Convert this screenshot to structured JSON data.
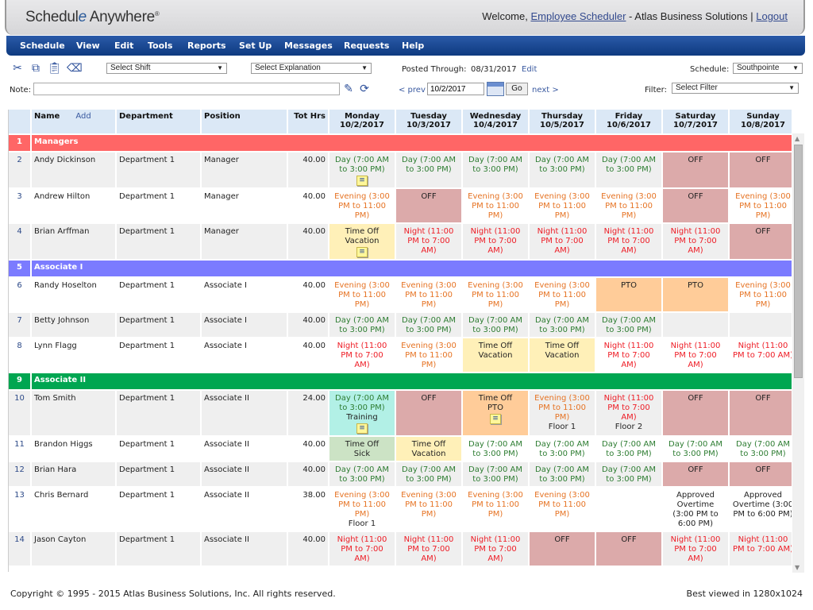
{
  "header": {
    "logo_prefix": "Schedul",
    "logo_e": "e",
    "logo_suffix": " Anywhere",
    "logo_reg": "®",
    "welcome_prefix": "Welcome, ",
    "user_link": "Employee Scheduler",
    "company": " - Atlas Business Solutions | ",
    "logout": "Logout"
  },
  "menu": [
    "Schedule",
    "View",
    "Edit",
    "Tools",
    "Reports",
    "Set Up",
    "Messages",
    "Requests",
    "Help"
  ],
  "toolbar": {
    "icons": [
      "cut-icon",
      "copy-icon",
      "paste-icon",
      "eraser-icon"
    ],
    "shift_select": "Select Shift",
    "explanation_select": "Select Explanation",
    "posted_through_label": "Posted Through:",
    "posted_through_date": "08/31/2017",
    "edit_link": "Edit",
    "note_label": "Note:",
    "note_value": "",
    "prev_link": "< prev",
    "date_value": "10/2/2017",
    "go_button": "Go",
    "next_link": "next >",
    "schedule_label": "Schedule:",
    "schedule_value": "Southpointe",
    "filter_label": "Filter:",
    "filter_value": "Select Filter"
  },
  "grid": {
    "headers": {
      "name": "Name",
      "add": "Add",
      "department": "Department",
      "position": "Position",
      "tot_hrs": "Tot Hrs",
      "days": [
        {
          "day": "Monday",
          "date": "10/2/2017"
        },
        {
          "day": "Tuesday",
          "date": "10/3/2017"
        },
        {
          "day": "Wednesday",
          "date": "10/4/2017"
        },
        {
          "day": "Thursday",
          "date": "10/5/2017"
        },
        {
          "day": "Friday",
          "date": "10/6/2017"
        },
        {
          "day": "Saturday",
          "date": "10/7/2017"
        },
        {
          "day": "Sunday",
          "date": "10/8/2017"
        }
      ]
    },
    "rows": [
      {
        "type": "group",
        "num": "1",
        "label": "Managers",
        "color": "#ff6666"
      },
      {
        "type": "emp",
        "num": "2",
        "name": "Andy Dickinson",
        "dept": "Department 1",
        "pos": "Manager",
        "hrs": "40.00",
        "cells": [
          {
            "kind": "day",
            "text": "Day (7:00 AM to 3:00 PM)",
            "note": true
          },
          {
            "kind": "day",
            "text": "Day (7:00 AM to 3:00 PM)"
          },
          {
            "kind": "day",
            "text": "Day (7:00 AM to 3:00 PM)"
          },
          {
            "kind": "day",
            "text": "Day (7:00 AM to 3:00 PM)"
          },
          {
            "kind": "day",
            "text": "Day (7:00 AM to 3:00 PM)"
          },
          {
            "kind": "off",
            "text": "OFF"
          },
          {
            "kind": "off",
            "text": "OFF"
          }
        ]
      },
      {
        "type": "emp",
        "num": "3",
        "name": "Andrew Hilton",
        "dept": "Department 1",
        "pos": "Manager",
        "hrs": "40.00",
        "cells": [
          {
            "kind": "eve",
            "text": "Evening (3:00 PM to 11:00 PM)"
          },
          {
            "kind": "off",
            "text": "OFF"
          },
          {
            "kind": "eve",
            "text": "Evening (3:00 PM to 11:00 PM)"
          },
          {
            "kind": "eve",
            "text": "Evening (3:00 PM to 11:00 PM)"
          },
          {
            "kind": "eve",
            "text": "Evening (3:00 PM to 11:00 PM)"
          },
          {
            "kind": "off",
            "text": "OFF"
          },
          {
            "kind": "eve",
            "text": "Evening (3:00 PM to 11:00 PM)"
          }
        ]
      },
      {
        "type": "emp",
        "num": "4",
        "name": "Brian Arffman",
        "dept": "Department 1",
        "pos": "Manager",
        "hrs": "40.00",
        "cells": [
          {
            "kind": "vac",
            "text": "Time Off",
            "sub": "Vacation",
            "note": true
          },
          {
            "kind": "night",
            "text": "Night (11:00 PM to 7:00 AM)"
          },
          {
            "kind": "night",
            "text": "Night (11:00 PM to 7:00 AM)"
          },
          {
            "kind": "night",
            "text": "Night (11:00 PM to 7:00 AM)"
          },
          {
            "kind": "night",
            "text": "Night (11:00 PM to 7:00 AM)"
          },
          {
            "kind": "night",
            "text": "Night (11:00 PM to 7:00 AM)"
          },
          {
            "kind": "off",
            "text": "OFF"
          }
        ]
      },
      {
        "type": "group",
        "num": "5",
        "label": "Associate I",
        "color": "#7b7bff"
      },
      {
        "type": "emp",
        "num": "6",
        "name": "Randy Hoselton",
        "dept": "Department 1",
        "pos": "Associate I",
        "hrs": "40.00",
        "cells": [
          {
            "kind": "eve",
            "text": "Evening (3:00 PM to 11:00 PM)"
          },
          {
            "kind": "eve",
            "text": "Evening (3:00 PM to 11:00 PM)"
          },
          {
            "kind": "eve",
            "text": "Evening (3:00 PM to 11:00 PM)"
          },
          {
            "kind": "eve",
            "text": "Evening (3:00 PM to 11:00 PM)"
          },
          {
            "kind": "pto",
            "text": "PTO"
          },
          {
            "kind": "pto",
            "text": "PTO"
          },
          {
            "kind": "eve",
            "text": "Evening (3:00 PM to 11:00 PM)"
          }
        ]
      },
      {
        "type": "emp",
        "num": "7",
        "name": "Betty Johnson",
        "dept": "Department 1",
        "pos": "Associate I",
        "hrs": "40.00",
        "cells": [
          {
            "kind": "day",
            "text": "Day (7:00 AM to 3:00 PM)"
          },
          {
            "kind": "day",
            "text": "Day (7:00 AM to 3:00 PM)"
          },
          {
            "kind": "day",
            "text": "Day (7:00 AM to 3:00 PM)"
          },
          {
            "kind": "day",
            "text": "Day (7:00 AM to 3:00 PM)"
          },
          {
            "kind": "day",
            "text": "Day (7:00 AM to 3:00 PM)"
          },
          {
            "kind": "empty",
            "text": ""
          },
          {
            "kind": "empty",
            "text": ""
          }
        ]
      },
      {
        "type": "emp",
        "num": "8",
        "name": "Lynn Flagg",
        "dept": "Department 1",
        "pos": "Associate I",
        "hrs": "40.00",
        "cells": [
          {
            "kind": "night",
            "text": "Night (11:00 PM to 7:00 AM)"
          },
          {
            "kind": "eve",
            "text": "Evening (3:00 PM to 11:00 PM)"
          },
          {
            "kind": "vac",
            "text": "Time Off",
            "sub": "Vacation"
          },
          {
            "kind": "vac",
            "text": "Time Off",
            "sub": "Vacation"
          },
          {
            "kind": "night",
            "text": "Night (11:00 PM to 7:00 AM)"
          },
          {
            "kind": "night",
            "text": "Night (11:00 PM to 7:00 AM)"
          },
          {
            "kind": "night",
            "text": "Night (11:00 PM to 7:00 AM)"
          }
        ]
      },
      {
        "type": "group",
        "num": "9",
        "label": "Associate II",
        "color": "#00a651"
      },
      {
        "type": "emp",
        "num": "10",
        "name": "Tom Smith",
        "dept": "Department 1",
        "pos": "Associate II",
        "hrs": "24.00",
        "cells": [
          {
            "kind": "train",
            "text": "Day (7:00 AM to 3:00 PM)",
            "sub": "Training",
            "note": true
          },
          {
            "kind": "off",
            "text": "OFF"
          },
          {
            "kind": "pto",
            "text": "Time Off",
            "sub": "PTO",
            "note": true
          },
          {
            "kind": "eve",
            "text": "Evening (3:00 PM to 11:00 PM)",
            "sub": "Floor 1"
          },
          {
            "kind": "night",
            "text": "Night (11:00 PM to 7:00 AM)",
            "sub": "Floor 2"
          },
          {
            "kind": "off",
            "text": "OFF"
          },
          {
            "kind": "off",
            "text": "OFF"
          }
        ]
      },
      {
        "type": "emp",
        "num": "11",
        "name": "Brandon Higgs",
        "dept": "Department 1",
        "pos": "Associate II",
        "hrs": "40.00",
        "cells": [
          {
            "kind": "sick",
            "text": "Time Off",
            "sub": "Sick"
          },
          {
            "kind": "vac",
            "text": "Time Off",
            "sub": "Vacation"
          },
          {
            "kind": "day",
            "text": "Day (7:00 AM to 3:00 PM)"
          },
          {
            "kind": "day",
            "text": "Day (7:00 AM to 3:00 PM)"
          },
          {
            "kind": "day",
            "text": "Day (7:00 AM to 3:00 PM)"
          },
          {
            "kind": "day",
            "text": "Day (7:00 AM to 3:00 PM)"
          },
          {
            "kind": "day",
            "text": "Day (7:00 AM to 3:00 PM)"
          }
        ]
      },
      {
        "type": "emp",
        "num": "12",
        "name": "Brian Hara",
        "dept": "Department 1",
        "pos": "Associate II",
        "hrs": "40.00",
        "cells": [
          {
            "kind": "day",
            "text": "Day (7:00 AM to 3:00 PM)"
          },
          {
            "kind": "day",
            "text": "Day (7:00 AM to 3:00 PM)"
          },
          {
            "kind": "day",
            "text": "Day (7:00 AM to 3:00 PM)"
          },
          {
            "kind": "day",
            "text": "Day (7:00 AM to 3:00 PM)"
          },
          {
            "kind": "day",
            "text": "Day (7:00 AM to 3:00 PM)"
          },
          {
            "kind": "off",
            "text": "OFF"
          },
          {
            "kind": "off",
            "text": "OFF"
          }
        ]
      },
      {
        "type": "emp",
        "num": "13",
        "name": "Chris Bernard",
        "dept": "Department 1",
        "pos": "Associate II",
        "hrs": "38.00",
        "cells": [
          {
            "kind": "eve",
            "text": "Evening (3:00 PM to 11:00 PM)",
            "sub": "Floor 1"
          },
          {
            "kind": "eve",
            "text": "Evening (3:00 PM to 11:00 PM)"
          },
          {
            "kind": "eve",
            "text": "Evening (3:00 PM to 11:00 PM)"
          },
          {
            "kind": "eve",
            "text": "Evening (3:00 PM to 11:00 PM)"
          },
          {
            "kind": "empty",
            "text": ""
          },
          {
            "kind": "plain",
            "text": "Approved Overtime (3:00 PM to 6:00 PM)"
          },
          {
            "kind": "plain",
            "text": "Approved Overtime (3:00 PM to 6:00 PM)"
          }
        ]
      },
      {
        "type": "emp",
        "num": "14",
        "name": "Jason Cayton",
        "dept": "Department 1",
        "pos": "Associate II",
        "hrs": "40.00",
        "cells": [
          {
            "kind": "night",
            "text": "Night (11:00 PM to 7:00 AM)"
          },
          {
            "kind": "night",
            "text": "Night (11:00 PM to 7:00 AM)"
          },
          {
            "kind": "night",
            "text": "Night (11:00 PM to 7:00 AM)"
          },
          {
            "kind": "off",
            "text": "OFF"
          },
          {
            "kind": "off",
            "text": "OFF"
          },
          {
            "kind": "night",
            "text": "Night (11:00 PM to 7:00 AM)"
          },
          {
            "kind": "night",
            "text": "Night (11:00 PM to 7:00 AM)"
          }
        ]
      }
    ]
  },
  "footer": {
    "copyright": "Copyright © 1995 - 2015 Atlas Business Solutions, Inc. All rights reserved.",
    "best_viewed": "Best viewed in 1280x1024"
  }
}
